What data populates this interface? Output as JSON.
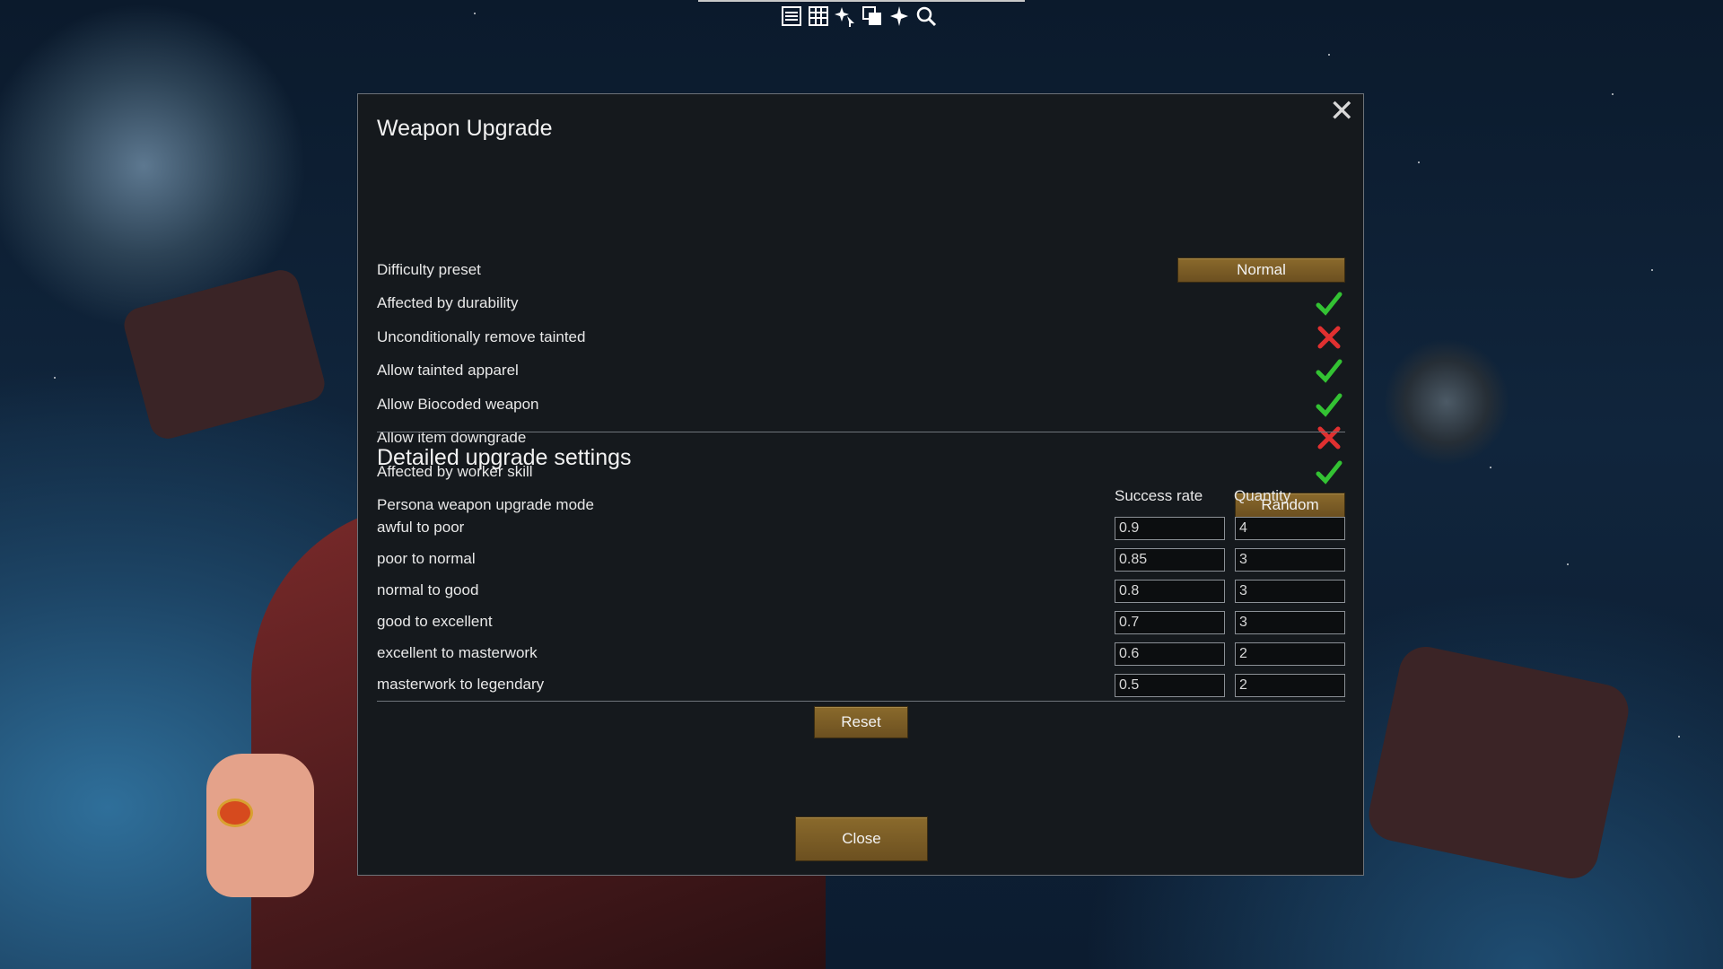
{
  "toolbar": {
    "icons": [
      "list-icon",
      "table-icon",
      "sparkle-arrow-icon",
      "copy-icon",
      "sparkle-icon",
      "search-icon"
    ]
  },
  "dialog": {
    "title": "Weapon Upgrade",
    "settings": {
      "difficulty_preset": {
        "label": "Difficulty preset",
        "value": "Normal"
      },
      "affected_by_durability": {
        "label": "Affected by durability",
        "checked": true
      },
      "unconditionally_remove_tainted": {
        "label": "Unconditionally remove tainted",
        "checked": false
      },
      "allow_tainted_apparel": {
        "label": "Allow tainted apparel",
        "checked": true
      },
      "allow_biocoded_weapon": {
        "label": "Allow Biocoded weapon",
        "checked": true
      },
      "allow_item_downgrade": {
        "label": "Allow item downgrade",
        "checked": false
      },
      "affected_by_worker_skill": {
        "label": "Affected by worker skill",
        "checked": true
      },
      "persona_weapon_upgrade_mode": {
        "label": "Persona weapon upgrade mode",
        "value": "Random"
      }
    },
    "detailed": {
      "title": "Detailed upgrade settings",
      "col_success": "Success rate",
      "col_quantity": "Quantity",
      "tiers": [
        {
          "label": "awful to poor",
          "success": "0.9",
          "quantity": "4"
        },
        {
          "label": "poor to normal",
          "success": "0.85",
          "quantity": "3"
        },
        {
          "label": "normal to good",
          "success": "0.8",
          "quantity": "3"
        },
        {
          "label": "good to excellent",
          "success": "0.7",
          "quantity": "3"
        },
        {
          "label": "excellent to masterwork",
          "success": "0.6",
          "quantity": "2"
        },
        {
          "label": "masterwork to legendary",
          "success": "0.5",
          "quantity": "2"
        }
      ]
    },
    "reset_label": "Reset",
    "close_label": "Close"
  },
  "colors": {
    "check_green": "#33c233",
    "cross_red": "#e03030",
    "button_gold": "#7a5c26"
  }
}
